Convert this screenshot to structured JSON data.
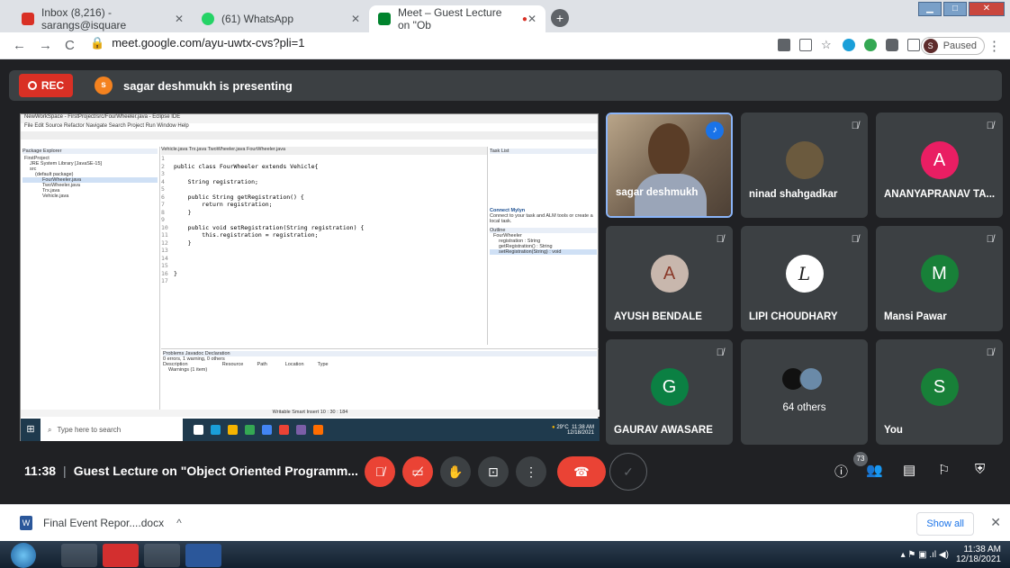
{
  "tabs": [
    {
      "label": "Inbox (8,216) - sarangs@isquare",
      "close": "✕",
      "color": "#d93025"
    },
    {
      "label": "(61) WhatsApp",
      "close": "✕",
      "color": "#25d366"
    },
    {
      "label": "Meet – Guest Lecture on \"Ob",
      "close": "✕",
      "color": "#00832d"
    }
  ],
  "newtab": "+",
  "window_controls": {
    "min": "▁",
    "max": "□",
    "close": "✕"
  },
  "address": {
    "url": "meet.google.com/ayu-uwtx-cvs?pli=1",
    "profile": "Paused",
    "profile_initial": "S"
  },
  "banner": {
    "rec": "REC",
    "presenter_initial": "s",
    "presenting": "sagar deshmukh is presenting"
  },
  "ide": {
    "title": "NewWorkSpace - FirstProject/src/FourWheeler.java - Eclipse IDE",
    "menu": "File  Edit  Source  Refactor  Navigate  Search  Project  Run  Window  Help",
    "pkg_title": "Package Explorer",
    "pkg_items": [
      "FirstProject",
      "JRE System Library [JavaSE-15]",
      "src",
      "(default package)",
      "FourWheeler.java",
      "TwoWheeler.java",
      "Trx.java",
      "Vehicle.java"
    ],
    "editor_tabs": "Vehicle.java   Trx.java   TwoWheeler.java   FourWheeler.java",
    "code": [
      {
        "n": "1",
        "t": ""
      },
      {
        "n": "2",
        "t": "public class FourWheeler extends Vehicle{"
      },
      {
        "n": "3",
        "t": ""
      },
      {
        "n": "4",
        "t": "    String registration;"
      },
      {
        "n": "5",
        "t": ""
      },
      {
        "n": "6",
        "t": "    public String getRegistration() {"
      },
      {
        "n": "7",
        "t": "        return registration;"
      },
      {
        "n": "8",
        "t": "    }"
      },
      {
        "n": "9",
        "t": ""
      },
      {
        "n": "10",
        "t": "    public void setRegistration(String registration) {"
      },
      {
        "n": "11",
        "t": "        this.registration = registration;"
      },
      {
        "n": "12",
        "t": "    }"
      },
      {
        "n": "13",
        "t": ""
      },
      {
        "n": "14",
        "t": ""
      },
      {
        "n": "15",
        "t": ""
      },
      {
        "n": "16",
        "t": "}"
      },
      {
        "n": "17",
        "t": ""
      }
    ],
    "outline_title": "Outline",
    "outline_items": [
      "FourWheeler",
      "registration : String",
      "getRegistration() : String",
      "setRegistration(String) : void"
    ],
    "mylyn": "Connect Mylyn",
    "mylyn_text": "Connect to your task and ALM tools or create a local task.",
    "problems_tabs": "Problems  Javadoc  Declaration",
    "problems_summary": "0 errors, 1 warning, 0 others",
    "problems_cols": "Description                         Resource          Path             Location          Type",
    "problems_row": "Warnings (1 item)",
    "status": "Writable          Smart Insert          10 : 30 : 184",
    "search_placeholder": "Type here to search",
    "tray_temp": "29°C",
    "tray_time": "11:38 AM",
    "tray_date": "12/18/2021"
  },
  "participants": [
    {
      "name": "sagar deshmukh",
      "type": "camera"
    },
    {
      "name": "ninad shahgadkar",
      "type": "photo",
      "color": "#6b5a3e"
    },
    {
      "name": "ANANYAPRANAV TA...",
      "initial": "A",
      "color": "#e91e63"
    },
    {
      "name": "AYUSH BENDALE",
      "initial": "A",
      "color": "#c8b7ad"
    },
    {
      "name": "LIPI CHOUDHARY",
      "initial": "L",
      "color": "#ffffff"
    },
    {
      "name": "Mansi Pawar",
      "initial": "M",
      "color": "#188038"
    },
    {
      "name": "GAURAV AWASARE",
      "initial": "G",
      "color": "#0b8043"
    },
    {
      "name": "64 others",
      "type": "others"
    },
    {
      "name": "You",
      "initial": "S",
      "color": "#188038"
    }
  ],
  "meetbar": {
    "time": "11:38",
    "title": "Guest Lecture on \"Object Oriented Programm...",
    "people_count": "73"
  },
  "download": {
    "file": "Final Event Repor....docx",
    "show_all": "Show all"
  },
  "taskbar": {
    "time": "11:38 AM",
    "date": "12/18/2021"
  }
}
